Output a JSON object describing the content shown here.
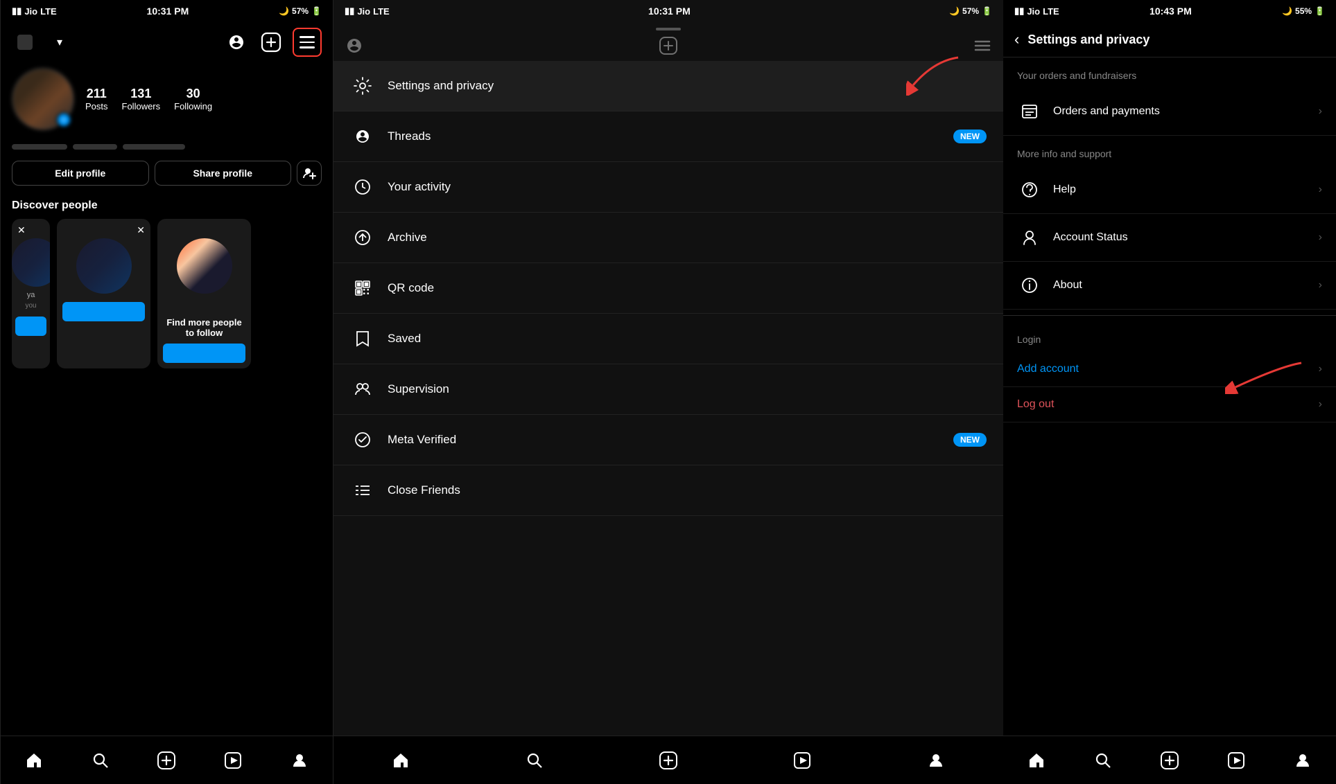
{
  "panel1": {
    "status": {
      "carrier": "Jio",
      "network": "LTE",
      "time": "10:31 PM",
      "battery": "57%"
    },
    "profile": {
      "posts": "211",
      "posts_label": "Posts",
      "followers": "131",
      "followers_label": "Followers",
      "following": "30",
      "following_label": "Following"
    },
    "buttons": {
      "edit": "Edit profile",
      "share": "Share profile"
    },
    "discover": {
      "title": "Discover people",
      "card2_desc": "Find more people to follow"
    },
    "nav": {
      "home": "🏠",
      "search": "🔍",
      "add": "➕",
      "reels": "▶",
      "profile": "👤"
    }
  },
  "panel2": {
    "status": {
      "carrier": "Jio",
      "network": "LTE",
      "time": "10:31 PM",
      "battery": "57%"
    },
    "menu_items": [
      {
        "id": "settings",
        "label": "Settings and privacy",
        "badge": "",
        "icon": "gear"
      },
      {
        "id": "threads",
        "label": "Threads",
        "badge": "NEW",
        "icon": "threads"
      },
      {
        "id": "activity",
        "label": "Your activity",
        "badge": "",
        "icon": "activity"
      },
      {
        "id": "archive",
        "label": "Archive",
        "badge": "",
        "icon": "archive"
      },
      {
        "id": "qr",
        "label": "QR code",
        "badge": "",
        "icon": "qr"
      },
      {
        "id": "saved",
        "label": "Saved",
        "badge": "",
        "icon": "saved"
      },
      {
        "id": "supervision",
        "label": "Supervision",
        "badge": "",
        "icon": "supervision"
      },
      {
        "id": "meta",
        "label": "Meta Verified",
        "badge": "NEW",
        "icon": "verified"
      },
      {
        "id": "friends",
        "label": "Close Friends",
        "badge": "",
        "icon": "friends"
      }
    ]
  },
  "panel3": {
    "status": {
      "carrier": "Jio",
      "network": "LTE",
      "time": "10:43 PM",
      "battery": "55%"
    },
    "title": "Settings and privacy",
    "section1": {
      "label": "Your orders and fundraisers",
      "items": [
        {
          "id": "orders",
          "label": "Orders and payments",
          "icon": "orders"
        }
      ]
    },
    "section2": {
      "label": "More info and support",
      "items": [
        {
          "id": "help",
          "label": "Help",
          "icon": "help"
        },
        {
          "id": "account-status",
          "label": "Account Status",
          "icon": "account-status"
        },
        {
          "id": "about",
          "label": "About",
          "icon": "about"
        }
      ]
    },
    "section3": {
      "label": "Login",
      "items": [
        {
          "id": "add-account",
          "label": "Add account",
          "color": "blue",
          "icon": ""
        },
        {
          "id": "log-out",
          "label": "Log out",
          "color": "red",
          "icon": ""
        }
      ]
    }
  }
}
